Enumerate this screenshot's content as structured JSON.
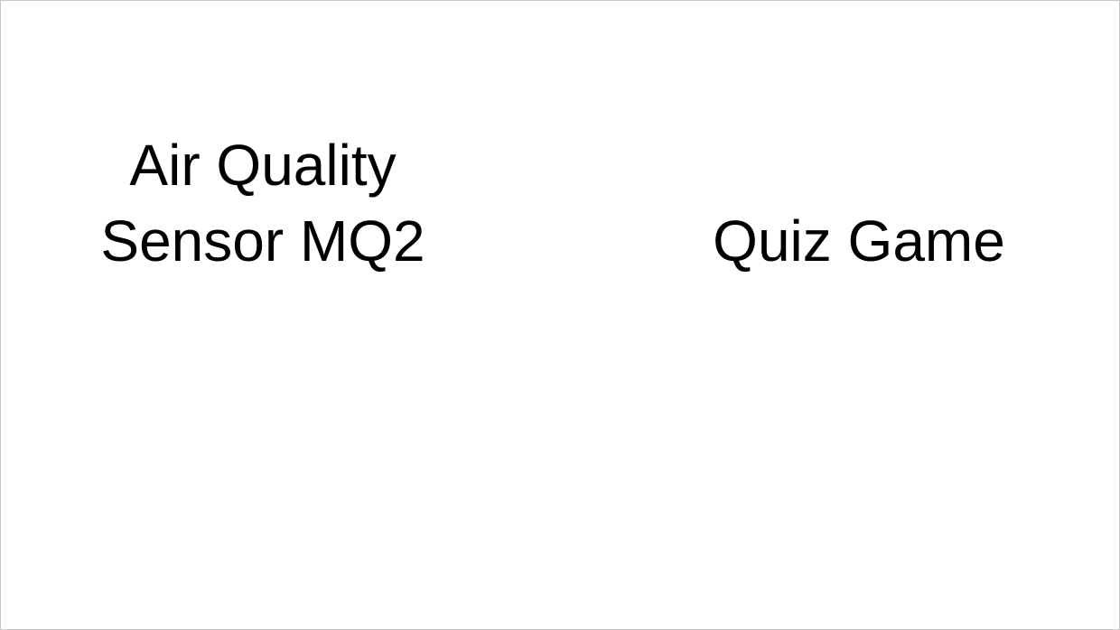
{
  "slide": {
    "left_title_lines": [
      "Air Quality",
      "Sensor MQ2"
    ],
    "right_title": "Quiz Game"
  }
}
